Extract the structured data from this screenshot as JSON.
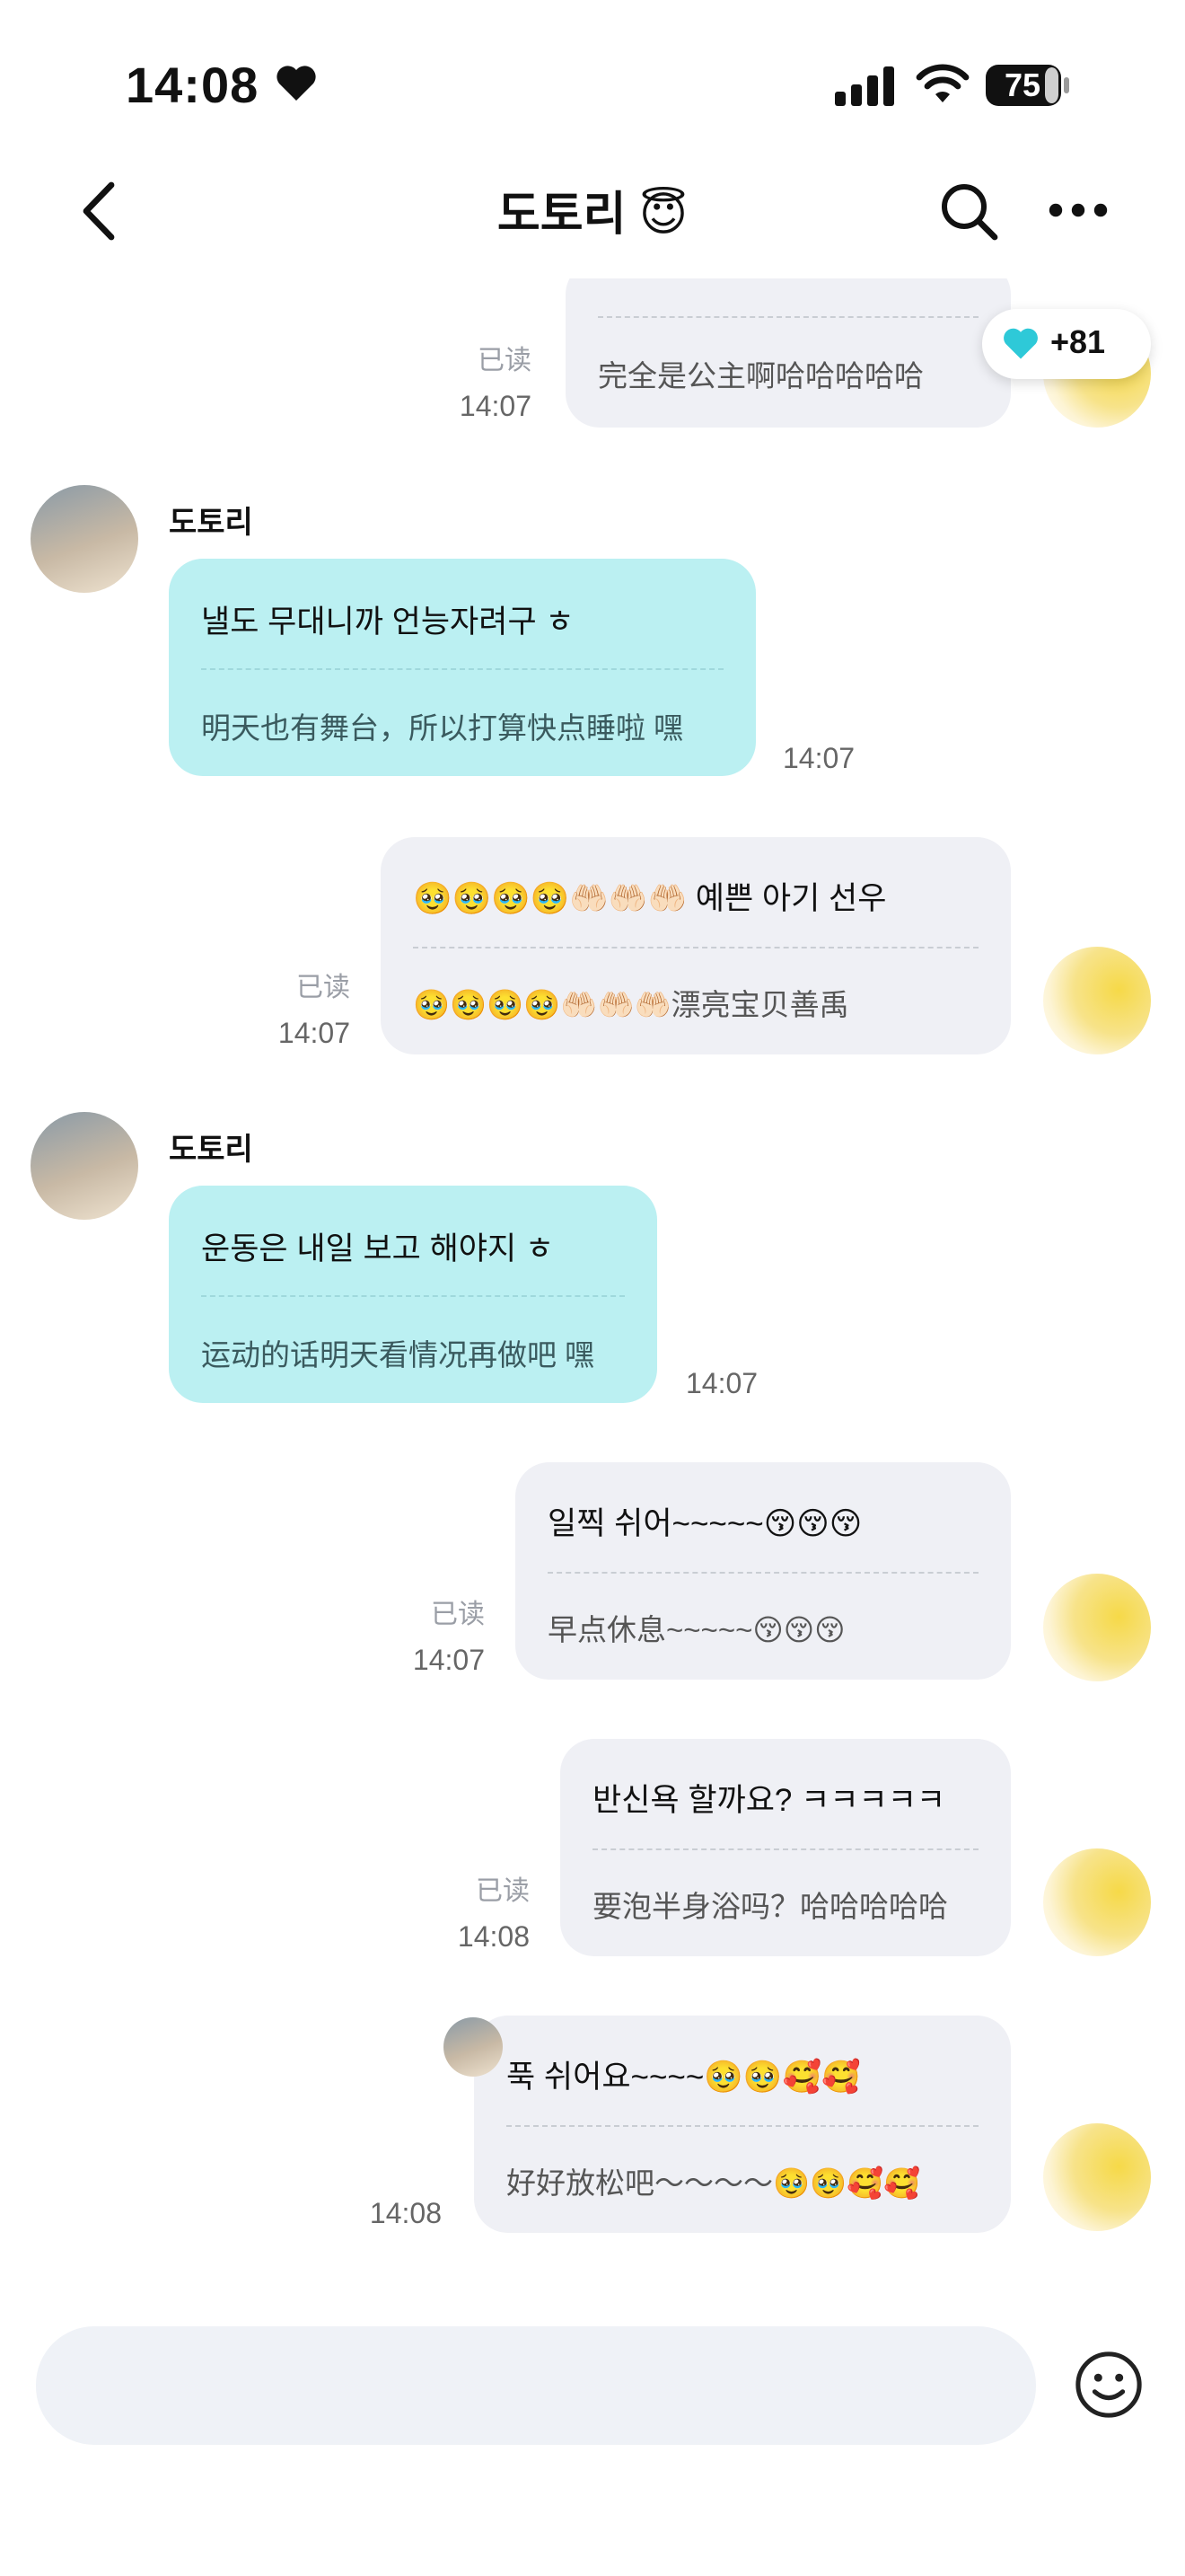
{
  "status": {
    "time": "14:08",
    "battery": "75"
  },
  "header": {
    "title": "도토리 😇"
  },
  "reaction": {
    "count": "+81"
  },
  "messages": {
    "m0": {
      "line2": "完全是公主啊哈哈哈哈哈",
      "read": "已读",
      "time": "14:07"
    },
    "m1": {
      "sender": "도토리",
      "line1": "낼도 무대니까 언능자려구 ㅎ",
      "line2": "明天也有舞台，所以打算快点睡啦 嘿",
      "time": "14:07"
    },
    "m2": {
      "line1": "🥹🥹🥹🥹🤲🏻🤲🏻🤲🏻 예쁜 아기 선우",
      "line2": "🥹🥹🥹🥹🤲🏻🤲🏻🤲🏻漂亮宝贝善禹",
      "read": "已读",
      "time": "14:07"
    },
    "m3": {
      "sender": "도토리",
      "line1": "운동은 내일 보고 해야지 ㅎ",
      "line2": "运动的话明天看情况再做吧 嘿",
      "time": "14:07"
    },
    "m4": {
      "line1": "일찍 쉬어~~~~~😚😚😚",
      "line2": "早点休息~~~~~😚😚😚",
      "read": "已读",
      "time": "14:07"
    },
    "m5": {
      "line1": "반신욕 할까요? ㅋㅋㅋㅋㅋ",
      "line2": "要泡半身浴吗？哈哈哈哈哈",
      "read": "已读",
      "time": "14:08"
    },
    "m6": {
      "line1": "푹 쉬어요~~~~🥹🥹🥰🥰",
      "line2": "好好放松吧～～～～🥹🥹🥰🥰",
      "time": "14:08"
    }
  },
  "composer": {
    "placeholder": ""
  },
  "colors": {
    "incoming_bubble": "#bbf0f2",
    "outgoing_bubble": "#eff0f5",
    "reaction_heart": "#2ec9d8"
  },
  "icons": [
    "heart-icon",
    "signal-icon",
    "wifi-icon",
    "battery-icon",
    "back-icon",
    "search-icon",
    "more-icon",
    "emoji-icon"
  ]
}
